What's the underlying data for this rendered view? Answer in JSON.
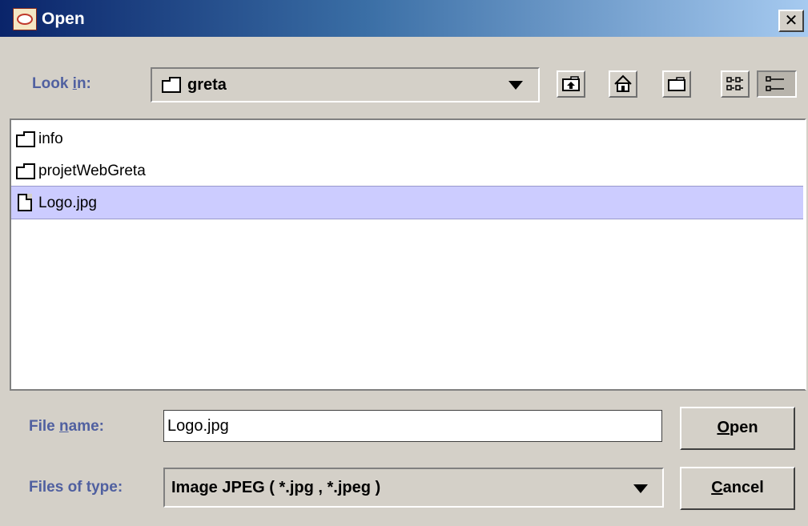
{
  "window": {
    "title": "Open",
    "close_glyph": "✕"
  },
  "look_in": {
    "label_pre": "Look ",
    "label_mn": "i",
    "label_post": "n:",
    "value": "greta"
  },
  "toolbar": {
    "buttons": [
      {
        "name": "up-one-level-button",
        "icon": "folder-up-icon"
      },
      {
        "name": "home-button",
        "icon": "home-icon"
      },
      {
        "name": "new-folder-button",
        "icon": "new-folder-icon"
      },
      {
        "name": "list-view-button",
        "icon": "list-view-icon"
      },
      {
        "name": "details-view-button",
        "icon": "details-view-icon"
      }
    ]
  },
  "files": [
    {
      "name": "info",
      "type": "folder",
      "selected": false
    },
    {
      "name": "projetWebGreta",
      "type": "folder",
      "selected": false
    },
    {
      "name": "Logo.jpg",
      "type": "file",
      "selected": true
    }
  ],
  "file_name": {
    "label_pre": "File ",
    "label_mn": "n",
    "label_post": "ame:",
    "value": "Logo.jpg"
  },
  "file_type": {
    "label": "Files of type:",
    "value": "Image JPEG ( *.jpg , *.jpeg )"
  },
  "buttons": {
    "open_mn": "O",
    "open_rest": "pen",
    "cancel_mn": "C",
    "cancel_rest": "ancel"
  },
  "colors": {
    "label_blue": "#5060a0",
    "selection": "#ccccff",
    "titlebar_start": "#0a246a",
    "titlebar_end": "#a6caf0"
  }
}
